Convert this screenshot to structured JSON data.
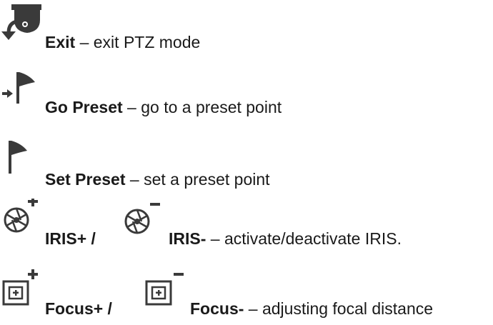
{
  "items": {
    "exit": {
      "icon": "exit-ptz-camera-icon",
      "title": "Exit",
      "desc": " – exit PTZ mode"
    },
    "go_preset": {
      "icon": "go-preset-flag-icon",
      "title": "Go Preset",
      "desc": " – go to a preset point"
    },
    "set_preset": {
      "icon": "set-preset-flag-icon",
      "title": "Set Preset",
      "desc": " – set a preset point"
    },
    "iris": {
      "plus_icon": "iris-plus-icon",
      "plus_title": "IRIS+ /",
      "minus_icon": "iris-minus-icon",
      "minus_title": "IRIS-",
      "desc": " – activate/deactivate IRIS."
    },
    "focus": {
      "plus_icon": "focus-plus-icon",
      "plus_title": "Focus+ /",
      "minus_icon": "focus-minus-icon",
      "minus_title": "Focus-",
      "desc": " – adjusting focal distance"
    }
  },
  "colors": {
    "icon": "#3a3a3a",
    "text": "#1a1a1a"
  }
}
